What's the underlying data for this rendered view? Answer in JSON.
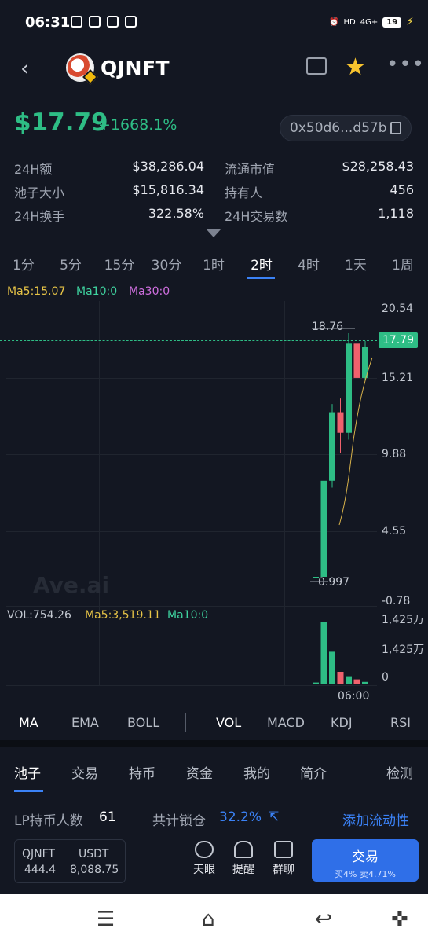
{
  "status_bar": {
    "time": "06:31",
    "network": "4G+",
    "hd": "HD",
    "battery": "19"
  },
  "header": {
    "token": "QJNFT"
  },
  "price": {
    "value": "$17.79",
    "change": "+1668.1%",
    "address": "0x50d6...d57b"
  },
  "stats": {
    "left": [
      {
        "label": "24H额",
        "value": "$38,286.04"
      },
      {
        "label": "池子大小",
        "value": "$15,816.34"
      },
      {
        "label": "24H换手",
        "value": "322.58%"
      }
    ],
    "right": [
      {
        "label": "流通市值",
        "value": "$28,258.43"
      },
      {
        "label": "持有人",
        "value": "456"
      },
      {
        "label": "24H交易数",
        "value": "1,118"
      }
    ]
  },
  "timeframes": [
    "1分",
    "5分",
    "15分",
    "30分",
    "1时",
    "2时",
    "4时",
    "1天",
    "1周"
  ],
  "active_timeframe": "2时",
  "ma": {
    "ma5": "Ma5:15.07",
    "ma10": "Ma10:0",
    "ma30": "Ma30:0"
  },
  "chart": {
    "y_ticks": [
      "20.54",
      "15.21",
      "9.88",
      "4.55",
      "-0.78"
    ],
    "current_price": "17.79",
    "high_label": "18.76",
    "low_label": "0.997",
    "watermark": "Ave.ai",
    "vol_ticks": [
      "1,425万",
      "1,425万",
      "0"
    ],
    "time_label": "06:00"
  },
  "chart_data": {
    "type": "candlestick",
    "ylim": [
      -0.78,
      20.54
    ],
    "candles": [
      {
        "open": 0.997,
        "close": 0.997,
        "high": 0.997,
        "low": 0.997
      },
      {
        "open": 0.997,
        "close": 8.0,
        "high": 8.5,
        "low": 0.997
      },
      {
        "open": 8.0,
        "close": 13.0,
        "high": 13.6,
        "low": 7.5
      },
      {
        "open": 13.0,
        "close": 11.5,
        "high": 14.0,
        "low": 10.0
      },
      {
        "open": 11.5,
        "close": 18.0,
        "high": 18.76,
        "low": 11.0
      },
      {
        "open": 18.0,
        "close": 15.5,
        "high": 18.3,
        "low": 15.0
      },
      {
        "open": 15.5,
        "close": 17.79,
        "high": 18.2,
        "low": 15.3
      }
    ],
    "volume_relative": [
      0.03,
      1.0,
      0.52,
      0.2,
      0.13,
      0.08,
      0.04
    ]
  },
  "vol": {
    "vol": "VOL:754.26",
    "ma5": "Ma5:3,519.11",
    "ma10": "Ma10:0"
  },
  "indicators": [
    "MA",
    "EMA",
    "BOLL",
    "VOL",
    "MACD",
    "KDJ",
    "RSI"
  ],
  "tabs": [
    "池子",
    "交易",
    "持币",
    "资金",
    "我的",
    "简介",
    "检测"
  ],
  "lp": {
    "label": "LP持币人数",
    "value": "61",
    "lock_label": "共计锁仓",
    "lock_value": "32.2%",
    "add": "添加流动性"
  },
  "pair": {
    "a": "QJNFT",
    "b": "USDT",
    "a_val": "444.4",
    "b_val": "8,088.75"
  },
  "actions": [
    "天眼",
    "提醒",
    "群聊"
  ],
  "trade": {
    "label": "交易",
    "fees": "买4% 卖4.71%"
  },
  "colors": {
    "up": "#2ebd85",
    "down": "#f0616d",
    "accent": "#3b82f6",
    "star": "#f7c32e"
  }
}
